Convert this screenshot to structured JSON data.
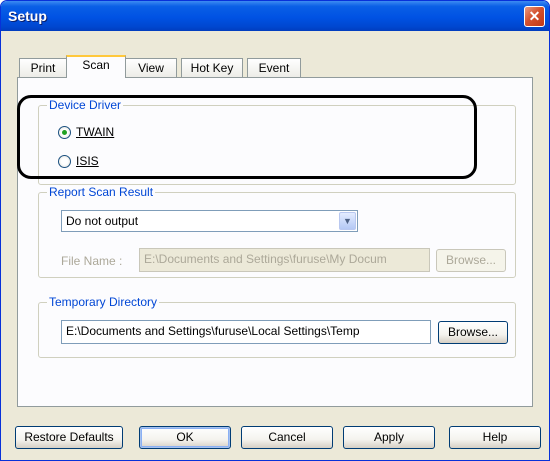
{
  "window": {
    "title": "Setup"
  },
  "tabs": [
    {
      "label": "Print"
    },
    {
      "label": "Scan"
    },
    {
      "label": "View"
    },
    {
      "label": "Hot Key"
    },
    {
      "label": "Event"
    }
  ],
  "device_driver": {
    "legend": "Device Driver",
    "options": [
      {
        "label": "TWAIN",
        "selected": true
      },
      {
        "label": "ISIS",
        "selected": false
      }
    ]
  },
  "report_scan_result": {
    "legend": "Report Scan Result",
    "dropdown_value": "Do not output",
    "file_name_label": "File Name :",
    "file_name_value": "E:\\Documents and Settings\\furuse\\My Docum",
    "browse_label": "Browse..."
  },
  "temporary_directory": {
    "legend": "Temporary Directory",
    "path_value": "E:\\Documents and Settings\\furuse\\Local Settings\\Temp",
    "browse_label": "Browse..."
  },
  "footer": {
    "restore_defaults_label": "Restore Defaults",
    "ok_label": "OK",
    "cancel_label": "Cancel",
    "apply_label": "Apply",
    "help_label": "Help"
  },
  "colors": {
    "title_bar": "#0054e3",
    "accent_label": "#0046d5",
    "annotation_outline": "#000000"
  }
}
